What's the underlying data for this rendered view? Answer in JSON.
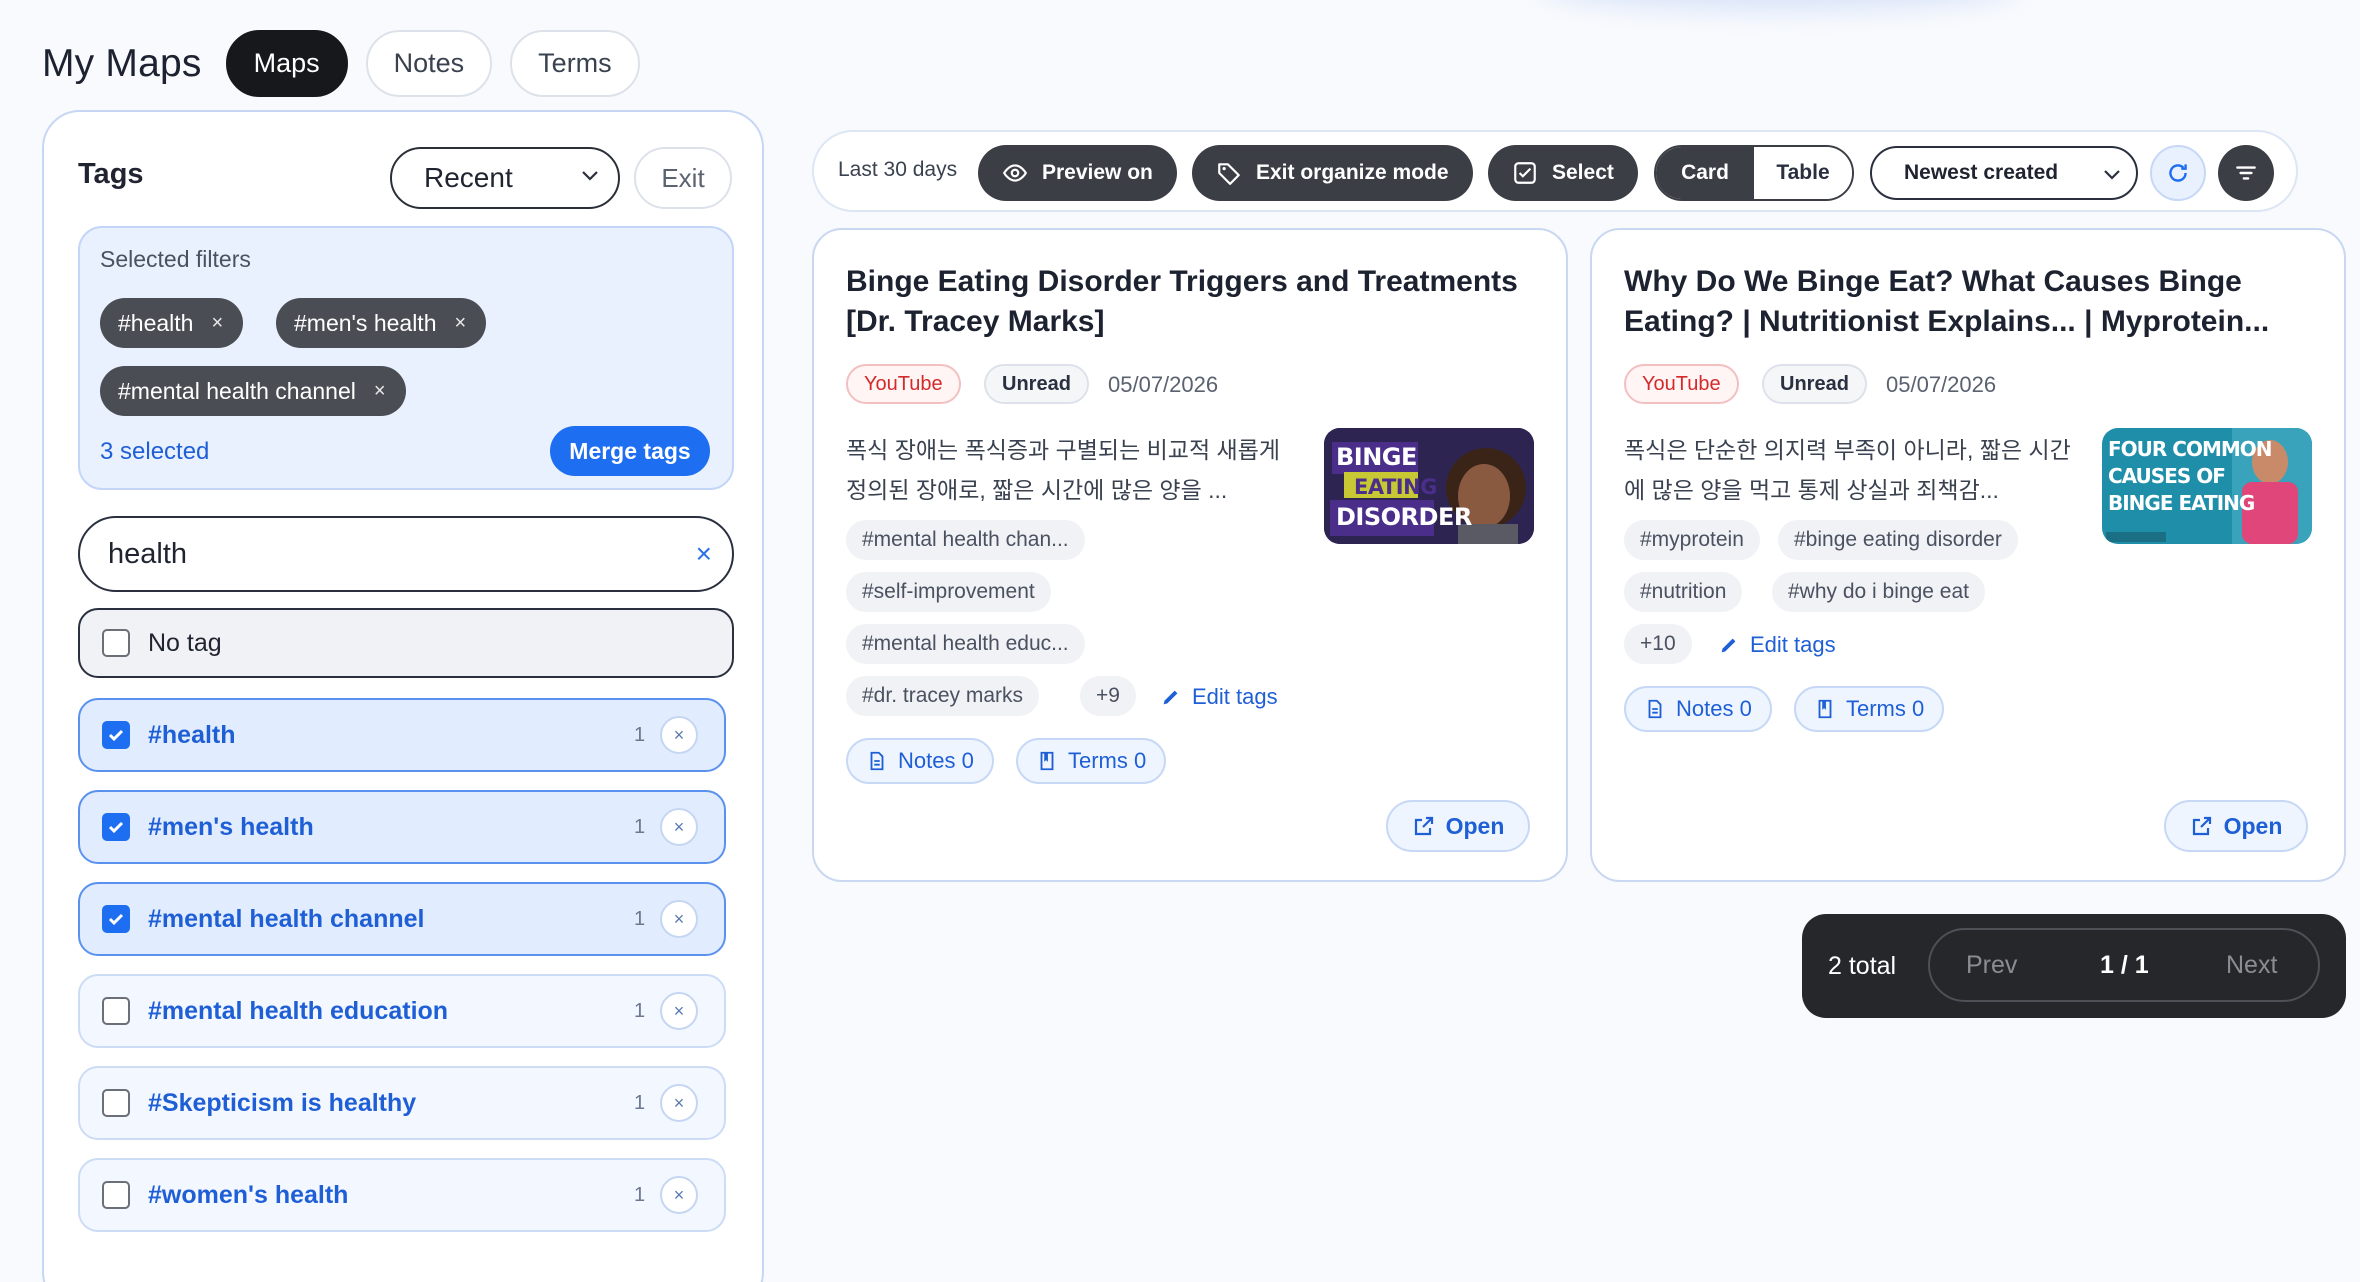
{
  "header": {
    "title": "My Maps",
    "tabs": [
      {
        "label": "Maps",
        "active": true
      },
      {
        "label": "Notes",
        "active": false
      },
      {
        "label": "Terms",
        "active": false
      }
    ]
  },
  "sidebar": {
    "title": "Tags",
    "sort_value": "Recent",
    "exit_label": "Exit",
    "selected_filters_label": "Selected filters",
    "selected_filters": [
      "#health",
      "#men's health",
      "#mental health channel"
    ],
    "remove_symbol": "×",
    "selected_count": "3 selected",
    "merge_label": "Merge tags",
    "search_value": "health",
    "no_tag_label": "No tag",
    "tags": [
      {
        "label": "#health",
        "count": "1",
        "checked": true
      },
      {
        "label": "#men's health",
        "count": "1",
        "checked": true
      },
      {
        "label": "#mental health channel",
        "count": "1",
        "checked": true
      },
      {
        "label": "#mental health education",
        "count": "1",
        "checked": false
      },
      {
        "label": "#Skepticism is healthy",
        "count": "1",
        "checked": false
      },
      {
        "label": "#women's health",
        "count": "1",
        "checked": false
      }
    ]
  },
  "toolbar": {
    "range": "Last 30 days",
    "preview": "Preview on",
    "organize": "Exit organize mode",
    "select": "Select",
    "view_card": "Card",
    "view_table": "Table",
    "sort": "Newest created"
  },
  "cards": [
    {
      "title": "Binge Eating Disorder Triggers and Treatments [Dr. Tracey Marks]",
      "source": "YouTube",
      "status": "Unread",
      "date": "05/07/2026",
      "summary": "폭식 장애는 폭식증과 구별되는 비교적 새롭게 정의된 장애로, 짧은 시간에 많은 양을 ...",
      "thumb_lines": [
        "BINGE",
        "EATING",
        "DISORDER"
      ],
      "tags": [
        "#mental health chan...",
        "#self-improvement",
        "#mental health educ...",
        "#dr. tracey marks"
      ],
      "more": "+9",
      "edit_tags": "Edit tags",
      "notes": "Notes 0",
      "terms": "Terms 0",
      "open": "Open"
    },
    {
      "title": "Why Do We Binge Eat? What Causes Binge Eating? | Nutritionist Explains... | Myprotein...",
      "source": "YouTube",
      "status": "Unread",
      "date": "05/07/2026",
      "summary": "폭식은 단순한 의지력 부족이 아니라, 짧은 시간에 많은 양을 먹고 통제 상실과 죄책감...",
      "thumb_lines": [
        "FOUR COMMON",
        "CAUSES OF",
        "BINGE EATING"
      ],
      "tags": [
        "#myprotein",
        "#binge eating disorder",
        "#nutrition",
        "#why do i binge eat"
      ],
      "more": "+10",
      "edit_tags": "Edit tags",
      "notes": "Notes 0",
      "terms": "Terms 0",
      "open": "Open"
    }
  ],
  "pagination": {
    "total": "2 total",
    "prev": "Prev",
    "page": "1 / 1",
    "next": "Next"
  },
  "colors": {
    "accent": "#1d6ef0",
    "link": "#1f5fd6",
    "dark": "#3b3e45",
    "youtube": "#d42a2a"
  }
}
